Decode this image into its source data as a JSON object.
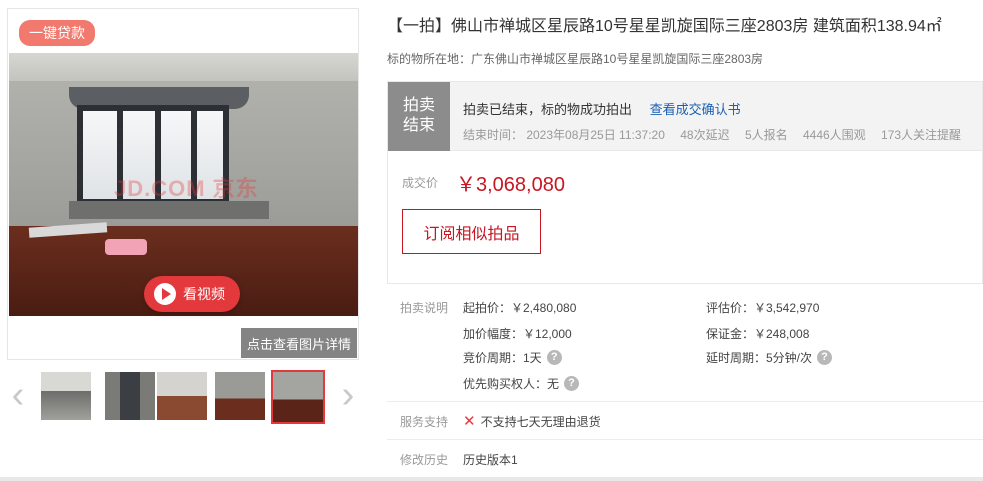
{
  "gallery": {
    "loan_badge": "一键贷款",
    "watermark": "JD.COM 京东",
    "play_label": "看视频",
    "detail_label": "点击查看图片详情"
  },
  "item": {
    "title": "【一拍】佛山市禅城区星辰路10号星星凯旋国际三座2803房 建筑面积138.94㎡",
    "location": "标的物所在地：广东佛山市禅城区星辰路10号星星凯旋国际三座2803房"
  },
  "status": {
    "tag_line1": "拍卖",
    "tag_line2": "结束",
    "message": "拍卖已结束，标的物成功拍出",
    "link": "查看成交确认书",
    "end_time": "结束时间： 2023年08月25日 11:37:20",
    "delays": "48次延迟",
    "signups": "5人报名",
    "viewers": "4446人围观",
    "reminders": "173人关注提醒"
  },
  "price": {
    "label": "成交价",
    "value": "￥3,068,080",
    "subscribe_label": "订阅相似拍品"
  },
  "rules": {
    "section_label": "拍卖说明",
    "start_price": "起拍价：￥2,480,080",
    "appraisal": "评估价：￥3,542,970",
    "increment": "加价幅度：￥12,000",
    "deposit": "保证金：￥248,008",
    "bid_cycle": "竞价周期：1天",
    "delay_cycle": "延时周期：5分钟/次",
    "priority": "优先购买权人：无"
  },
  "service": {
    "label": "服务支持",
    "value": "不支持七天无理由退货"
  },
  "history": {
    "label": "修改历史",
    "value": "历史版本1"
  },
  "icons": {
    "prev": "chevron-left-icon",
    "next": "chevron-right-icon",
    "help": "help-circle-icon",
    "cross": "cross-icon",
    "play": "play-icon"
  },
  "colors": {
    "accent_red": "#c81623",
    "badge": "#f2796d",
    "status_tag": "#8c8c8c",
    "link_blue": "#1a5fb4"
  }
}
